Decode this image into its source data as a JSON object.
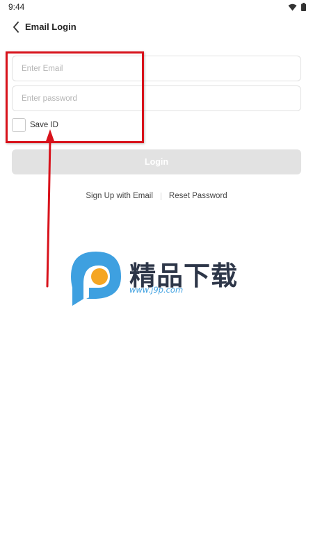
{
  "status_bar": {
    "time": "9:44"
  },
  "header": {
    "title": "Email Login",
    "back_icon": "chevron-left-icon"
  },
  "form": {
    "email_placeholder": "Enter Email",
    "password_placeholder": "Enter password",
    "save_id_label": "Save ID",
    "save_id_checked": false,
    "login_label": "Login"
  },
  "links": {
    "signup_label": "Sign Up with Email",
    "reset_label": "Reset Password"
  },
  "annotation": {
    "color": "#d8121b"
  },
  "watermark": {
    "brand_text": "精品下载",
    "url": "www.j9p.com"
  },
  "colors": {
    "login_disabled": "#e2e2e2",
    "watermark_blue": "#3ea0e0",
    "watermark_orange": "#f5a623"
  }
}
